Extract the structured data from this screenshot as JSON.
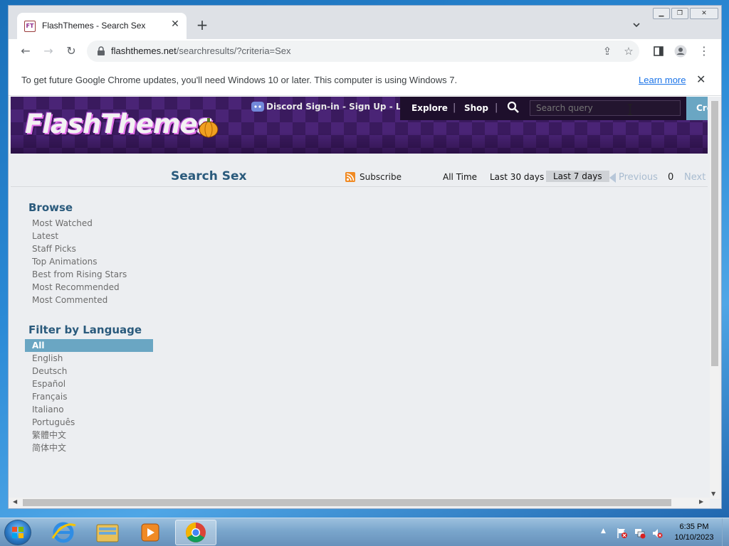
{
  "browser": {
    "tab_title": "FlashThemes - Search Sex",
    "url_host": "flashthemes.net",
    "url_path": "/searchresults/?criteria=Sex",
    "infobar_text": "To get future Google Chrome updates, you'll need Windows 10 or later. This computer is using Windows 7.",
    "infobar_link": "Learn more"
  },
  "site": {
    "logo_text": "FlashThemes",
    "signin_text": "Discord Sign-in - Sign Up - Login",
    "nav": [
      "Explore",
      "Shop"
    ],
    "search_placeholder": "Search query",
    "create_label": "Cre"
  },
  "results": {
    "title": "Search Sex",
    "subscribe": "Subscribe",
    "periods": [
      "All Time",
      "Last 30 days",
      "Last 7 days"
    ],
    "active_period": "Last 7 days",
    "pager_previous": "Previous",
    "page_number": "0",
    "pager_next": "Next"
  },
  "sidebar": {
    "browse_heading": "Browse",
    "browse_items": [
      "Most Watched",
      "Latest",
      "Staff Picks",
      "Top Animations",
      "Best from Rising Stars",
      "Most Recommended",
      "Most Commented"
    ],
    "language_heading": "Filter by Language",
    "languages": [
      "All",
      "English",
      "Deutsch",
      "Español",
      "Français",
      "Italiano",
      "Português",
      "繁體中文",
      "简体中文"
    ],
    "selected_language": "All"
  },
  "taskbar": {
    "time": "6:35 PM",
    "date": "10/10/2023",
    "pinned": [
      "internet-explorer-icon",
      "file-explorer-icon",
      "media-player-icon",
      "chrome-icon"
    ],
    "active_app": "chrome-icon"
  },
  "colors": {
    "header_purple": "#3a1a5e",
    "accent_teal": "#6aa6c3",
    "heading_blue": "#2a5a7c"
  }
}
